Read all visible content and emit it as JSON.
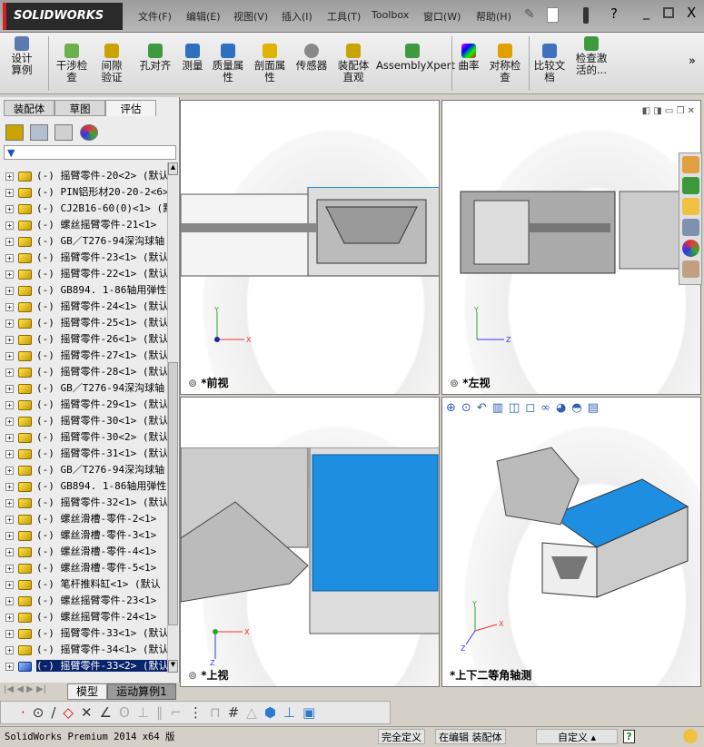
{
  "app": {
    "logo": "SOLIDWORKS"
  },
  "menu": [
    "文件(F)",
    "编辑(E)",
    "视图(V)",
    "插入(I)",
    "工具(T)",
    "Toolbox",
    "窗口(W)",
    "帮助(H)"
  ],
  "ribbon": [
    {
      "label": "设计算例",
      "icon": "design-study-icon",
      "color": "#5a7ab0"
    },
    {
      "label": "干涉检查",
      "icon": "interference-icon",
      "color": "#6ab04c"
    },
    {
      "label": "间隙验证",
      "icon": "clearance-icon",
      "color": "#c9a400"
    },
    {
      "label": "孔对齐",
      "icon": "hole-align-icon",
      "color": "#3f9a3f"
    },
    {
      "label": "测量",
      "icon": "measure-icon",
      "color": "#2f6fc0"
    },
    {
      "label": "质量属性",
      "icon": "mass-props-icon",
      "color": "#2f6fc0"
    },
    {
      "label": "剖面属性",
      "icon": "section-props-icon",
      "color": "#e0b400"
    },
    {
      "label": "传感器",
      "icon": "sensor-icon",
      "color": "#888888"
    },
    {
      "label": "装配体直观",
      "icon": "assembly-visual-icon",
      "color": "#c9a400"
    },
    {
      "label": "AssemblyXpert",
      "icon": "assemblyxpert-icon",
      "color": "#3f9a3f"
    },
    {
      "label": "曲率",
      "icon": "curvature-icon",
      "color": "#d02090"
    },
    {
      "label": "对称检查",
      "icon": "symmetry-icon",
      "color": "#e0a000"
    },
    {
      "label": "比较文档",
      "icon": "compare-icon",
      "color": "#4070c0"
    },
    {
      "label": "检查激活的...",
      "icon": "check-active-icon",
      "color": "#3f9a3f"
    }
  ],
  "panel_tabs": [
    "装配体",
    "草图",
    "评估"
  ],
  "tree": [
    "(-) 摇臂零件-20<2> (默认",
    "(-) PIN铝形材20-20-2<6>",
    "(-) CJ2B16-60(0)<1> (默",
    "(-) 螺丝摇臂零件-21<1>",
    "(-) GB／T276-94深沟球轴",
    "(-) 摇臂零件-23<1> (默认",
    "(-) 摇臂零件-22<1> (默认",
    "(-) GB894. 1-86轴用弹性",
    "(-) 摇臂零件-24<1> (默认",
    "(-) 摇臂零件-25<1> (默认",
    "(-) 摇臂零件-26<1> (默认",
    "(-) 摇臂零件-27<1> (默认",
    "(-) 摇臂零件-28<1> (默认",
    "(-) GB／T276-94深沟球轴",
    "(-) 摇臂零件-29<1> (默认",
    "(-) 摇臂零件-30<1> (默认",
    "(-) 摇臂零件-30<2> (默认",
    "(-) 摇臂零件-31<1> (默认",
    "(-) GB／T276-94深沟球轴",
    "(-) GB894. 1-86轴用弹性",
    "(-) 摇臂零件-32<1> (默认",
    "(-) 螺丝滑槽-零件-2<1>",
    "(-) 螺丝滑槽-零件-3<1>",
    "(-) 螺丝滑槽-零件-4<1>",
    "(-) 螺丝滑槽-零件-5<1>",
    "(-) 笔杆推料缸<1> (默认",
    "(-) 螺丝摇臂零件-23<1>",
    "(-) 螺丝摇臂零件-24<1>",
    "(-) 摇臂零件-33<1> (默认",
    "(-) 摇臂零件-34<1> (默认",
    "(-) 摇臂零件-33<2> (默认"
  ],
  "tree_selected_index": 30,
  "viewports": {
    "front": "*前视",
    "left": "*左视",
    "top": "*上视",
    "iso": "*上下二等角轴测"
  },
  "axes": {
    "x": "X",
    "y": "Y",
    "z": "Z"
  },
  "bottom_tabs": [
    "模型",
    "运动算例1"
  ],
  "status": {
    "version": "SolidWorks Premium 2014 x64 版",
    "defined": "完全定义",
    "editing": "在编辑 装配体",
    "custom": "自定义"
  },
  "colors": {
    "face_blue": "#1e8ee0",
    "selection": "#0a246a",
    "brand_red": "#d21f1f"
  }
}
